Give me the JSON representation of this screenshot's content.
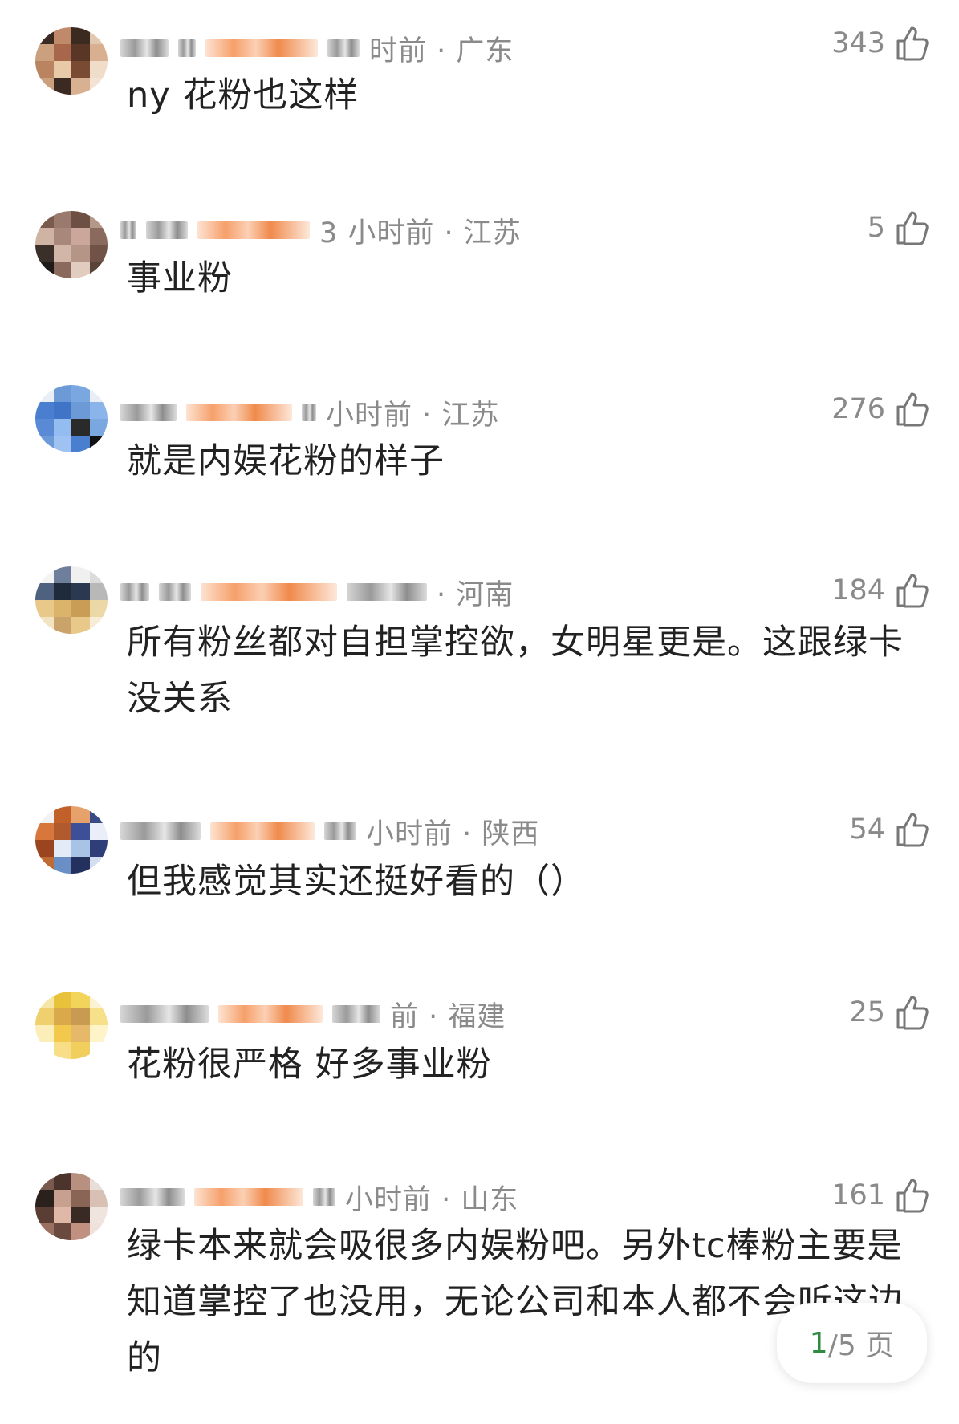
{
  "comments": [
    {
      "meta": "时前 · 广东",
      "likes": "343",
      "text": "ny 花粉也这样"
    },
    {
      "meta": "3 小时前 · 江苏",
      "likes": "5",
      "text": "事业粉"
    },
    {
      "meta": "小时前 · 江苏",
      "likes": "276",
      "text": "就是内娱花粉的样子"
    },
    {
      "meta": "· 河南",
      "likes": "184",
      "text": "所有粉丝都对自担掌控欲，女明星更是。这跟绿卡没关系"
    },
    {
      "meta": "小时前 · 陕西",
      "likes": "54",
      "text": "但我感觉其实还挺好看的（）"
    },
    {
      "meta": "前 · 福建",
      "likes": "25",
      "text": "花粉很严格 好多事业粉"
    },
    {
      "meta": "小时前 · 山东",
      "likes": "161",
      "text": "绿卡本来就会吸很多内娱粉吧。另外tc棒粉主要是知道掌控了也没用，无论公司和本人都不会听这边的"
    }
  ],
  "pager": {
    "current": "1",
    "total": "/5 页"
  },
  "colors": {
    "meta_gray": "#8a8a8a",
    "text": "#222222",
    "pager_accent": "#2e8b3f"
  }
}
